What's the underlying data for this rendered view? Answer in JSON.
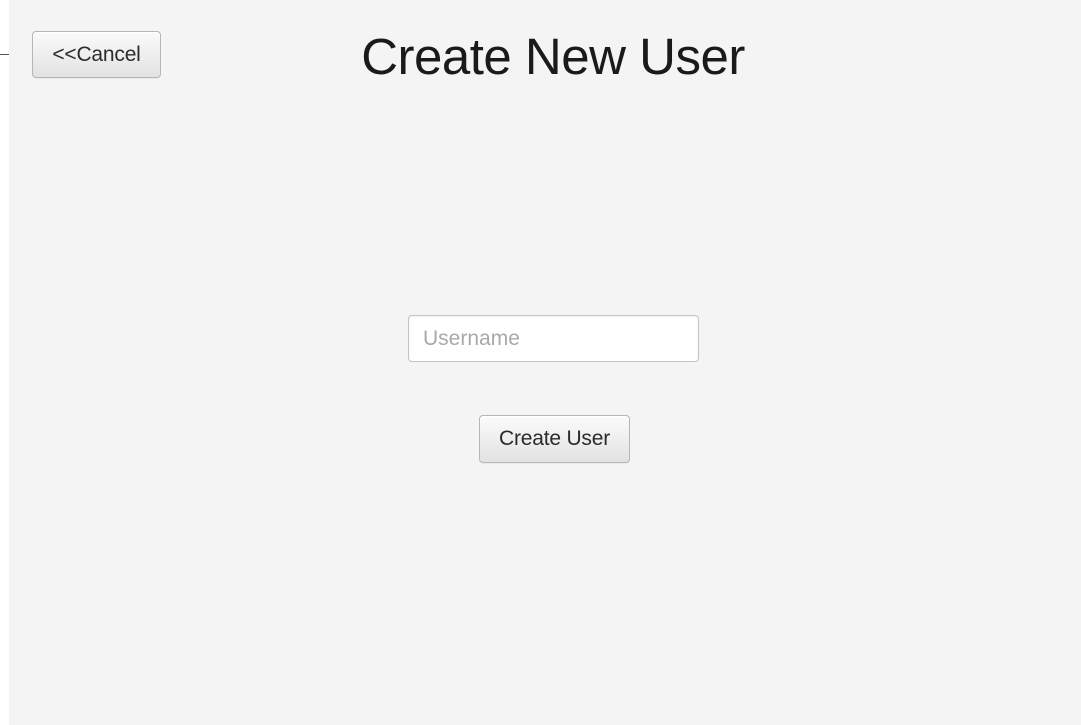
{
  "window": {
    "title": "Create New User"
  },
  "toolbar": {
    "cancel_label": "<<Cancel"
  },
  "form": {
    "username": {
      "value": "",
      "placeholder": "Username"
    },
    "submit_label": "Create User"
  },
  "colors": {
    "background": "#f4f4f4",
    "button_border": "#b6b6b6",
    "placeholder_text": "#a9a9a9",
    "title_text": "#1a1a1a"
  }
}
